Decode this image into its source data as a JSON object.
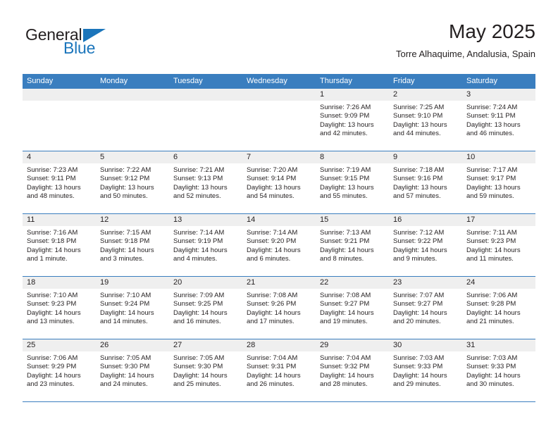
{
  "brand": {
    "word1": "General",
    "word2": "Blue",
    "logo_icon": "triangle-logo-icon",
    "accent_color": "#1b75bb"
  },
  "header": {
    "title": "May 2025",
    "location": "Torre Alhaquime, Andalusia, Spain"
  },
  "calendar": {
    "header_bg": "#3a7ebf",
    "day_band_bg": "#efefef",
    "weekdays": [
      "Sunday",
      "Monday",
      "Tuesday",
      "Wednesday",
      "Thursday",
      "Friday",
      "Saturday"
    ],
    "weeks": [
      [
        {
          "day": "",
          "empty": true
        },
        {
          "day": "",
          "empty": true
        },
        {
          "day": "",
          "empty": true
        },
        {
          "day": "",
          "empty": true
        },
        {
          "day": "1",
          "sunrise": "Sunrise: 7:26 AM",
          "sunset": "Sunset: 9:09 PM",
          "daylight1": "Daylight: 13 hours",
          "daylight2": "and 42 minutes."
        },
        {
          "day": "2",
          "sunrise": "Sunrise: 7:25 AM",
          "sunset": "Sunset: 9:10 PM",
          "daylight1": "Daylight: 13 hours",
          "daylight2": "and 44 minutes."
        },
        {
          "day": "3",
          "sunrise": "Sunrise: 7:24 AM",
          "sunset": "Sunset: 9:11 PM",
          "daylight1": "Daylight: 13 hours",
          "daylight2": "and 46 minutes."
        }
      ],
      [
        {
          "day": "4",
          "sunrise": "Sunrise: 7:23 AM",
          "sunset": "Sunset: 9:11 PM",
          "daylight1": "Daylight: 13 hours",
          "daylight2": "and 48 minutes."
        },
        {
          "day": "5",
          "sunrise": "Sunrise: 7:22 AM",
          "sunset": "Sunset: 9:12 PM",
          "daylight1": "Daylight: 13 hours",
          "daylight2": "and 50 minutes."
        },
        {
          "day": "6",
          "sunrise": "Sunrise: 7:21 AM",
          "sunset": "Sunset: 9:13 PM",
          "daylight1": "Daylight: 13 hours",
          "daylight2": "and 52 minutes."
        },
        {
          "day": "7",
          "sunrise": "Sunrise: 7:20 AM",
          "sunset": "Sunset: 9:14 PM",
          "daylight1": "Daylight: 13 hours",
          "daylight2": "and 54 minutes."
        },
        {
          "day": "8",
          "sunrise": "Sunrise: 7:19 AM",
          "sunset": "Sunset: 9:15 PM",
          "daylight1": "Daylight: 13 hours",
          "daylight2": "and 55 minutes."
        },
        {
          "day": "9",
          "sunrise": "Sunrise: 7:18 AM",
          "sunset": "Sunset: 9:16 PM",
          "daylight1": "Daylight: 13 hours",
          "daylight2": "and 57 minutes."
        },
        {
          "day": "10",
          "sunrise": "Sunrise: 7:17 AM",
          "sunset": "Sunset: 9:17 PM",
          "daylight1": "Daylight: 13 hours",
          "daylight2": "and 59 minutes."
        }
      ],
      [
        {
          "day": "11",
          "sunrise": "Sunrise: 7:16 AM",
          "sunset": "Sunset: 9:18 PM",
          "daylight1": "Daylight: 14 hours",
          "daylight2": "and 1 minute."
        },
        {
          "day": "12",
          "sunrise": "Sunrise: 7:15 AM",
          "sunset": "Sunset: 9:18 PM",
          "daylight1": "Daylight: 14 hours",
          "daylight2": "and 3 minutes."
        },
        {
          "day": "13",
          "sunrise": "Sunrise: 7:14 AM",
          "sunset": "Sunset: 9:19 PM",
          "daylight1": "Daylight: 14 hours",
          "daylight2": "and 4 minutes."
        },
        {
          "day": "14",
          "sunrise": "Sunrise: 7:14 AM",
          "sunset": "Sunset: 9:20 PM",
          "daylight1": "Daylight: 14 hours",
          "daylight2": "and 6 minutes."
        },
        {
          "day": "15",
          "sunrise": "Sunrise: 7:13 AM",
          "sunset": "Sunset: 9:21 PM",
          "daylight1": "Daylight: 14 hours",
          "daylight2": "and 8 minutes."
        },
        {
          "day": "16",
          "sunrise": "Sunrise: 7:12 AM",
          "sunset": "Sunset: 9:22 PM",
          "daylight1": "Daylight: 14 hours",
          "daylight2": "and 9 minutes."
        },
        {
          "day": "17",
          "sunrise": "Sunrise: 7:11 AM",
          "sunset": "Sunset: 9:23 PM",
          "daylight1": "Daylight: 14 hours",
          "daylight2": "and 11 minutes."
        }
      ],
      [
        {
          "day": "18",
          "sunrise": "Sunrise: 7:10 AM",
          "sunset": "Sunset: 9:23 PM",
          "daylight1": "Daylight: 14 hours",
          "daylight2": "and 13 minutes."
        },
        {
          "day": "19",
          "sunrise": "Sunrise: 7:10 AM",
          "sunset": "Sunset: 9:24 PM",
          "daylight1": "Daylight: 14 hours",
          "daylight2": "and 14 minutes."
        },
        {
          "day": "20",
          "sunrise": "Sunrise: 7:09 AM",
          "sunset": "Sunset: 9:25 PM",
          "daylight1": "Daylight: 14 hours",
          "daylight2": "and 16 minutes."
        },
        {
          "day": "21",
          "sunrise": "Sunrise: 7:08 AM",
          "sunset": "Sunset: 9:26 PM",
          "daylight1": "Daylight: 14 hours",
          "daylight2": "and 17 minutes."
        },
        {
          "day": "22",
          "sunrise": "Sunrise: 7:08 AM",
          "sunset": "Sunset: 9:27 PM",
          "daylight1": "Daylight: 14 hours",
          "daylight2": "and 19 minutes."
        },
        {
          "day": "23",
          "sunrise": "Sunrise: 7:07 AM",
          "sunset": "Sunset: 9:27 PM",
          "daylight1": "Daylight: 14 hours",
          "daylight2": "and 20 minutes."
        },
        {
          "day": "24",
          "sunrise": "Sunrise: 7:06 AM",
          "sunset": "Sunset: 9:28 PM",
          "daylight1": "Daylight: 14 hours",
          "daylight2": "and 21 minutes."
        }
      ],
      [
        {
          "day": "25",
          "sunrise": "Sunrise: 7:06 AM",
          "sunset": "Sunset: 9:29 PM",
          "daylight1": "Daylight: 14 hours",
          "daylight2": "and 23 minutes."
        },
        {
          "day": "26",
          "sunrise": "Sunrise: 7:05 AM",
          "sunset": "Sunset: 9:30 PM",
          "daylight1": "Daylight: 14 hours",
          "daylight2": "and 24 minutes."
        },
        {
          "day": "27",
          "sunrise": "Sunrise: 7:05 AM",
          "sunset": "Sunset: 9:30 PM",
          "daylight1": "Daylight: 14 hours",
          "daylight2": "and 25 minutes."
        },
        {
          "day": "28",
          "sunrise": "Sunrise: 7:04 AM",
          "sunset": "Sunset: 9:31 PM",
          "daylight1": "Daylight: 14 hours",
          "daylight2": "and 26 minutes."
        },
        {
          "day": "29",
          "sunrise": "Sunrise: 7:04 AM",
          "sunset": "Sunset: 9:32 PM",
          "daylight1": "Daylight: 14 hours",
          "daylight2": "and 28 minutes."
        },
        {
          "day": "30",
          "sunrise": "Sunrise: 7:03 AM",
          "sunset": "Sunset: 9:33 PM",
          "daylight1": "Daylight: 14 hours",
          "daylight2": "and 29 minutes."
        },
        {
          "day": "31",
          "sunrise": "Sunrise: 7:03 AM",
          "sunset": "Sunset: 9:33 PM",
          "daylight1": "Daylight: 14 hours",
          "daylight2": "and 30 minutes."
        }
      ]
    ]
  }
}
